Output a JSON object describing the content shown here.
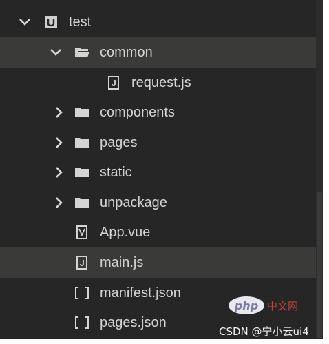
{
  "tree": {
    "root": {
      "label": "test",
      "icon": "project-icon",
      "expanded": true
    },
    "items": [
      {
        "label": "common",
        "icon": "folder-open-icon",
        "expanded": true
      },
      {
        "label": "request.js",
        "icon": "js-file-icon"
      },
      {
        "label": "components",
        "icon": "folder-icon"
      },
      {
        "label": "pages",
        "icon": "folder-icon"
      },
      {
        "label": "static",
        "icon": "folder-icon"
      },
      {
        "label": "unpackage",
        "icon": "folder-icon"
      },
      {
        "label": "App.vue",
        "icon": "vue-file-icon"
      },
      {
        "label": "main.js",
        "icon": "js-file-icon"
      },
      {
        "label": "manifest.json",
        "icon": "json-file-icon"
      },
      {
        "label": "pages.json",
        "icon": "json-file-icon"
      }
    ]
  },
  "watermark": {
    "php_logo": "php",
    "php_site": "中文网",
    "csdn": "CSDN @宁小云ui4"
  },
  "colors": {
    "background": "#262626",
    "selected_row": "#3a3a38",
    "text": "#d4d4d4"
  }
}
